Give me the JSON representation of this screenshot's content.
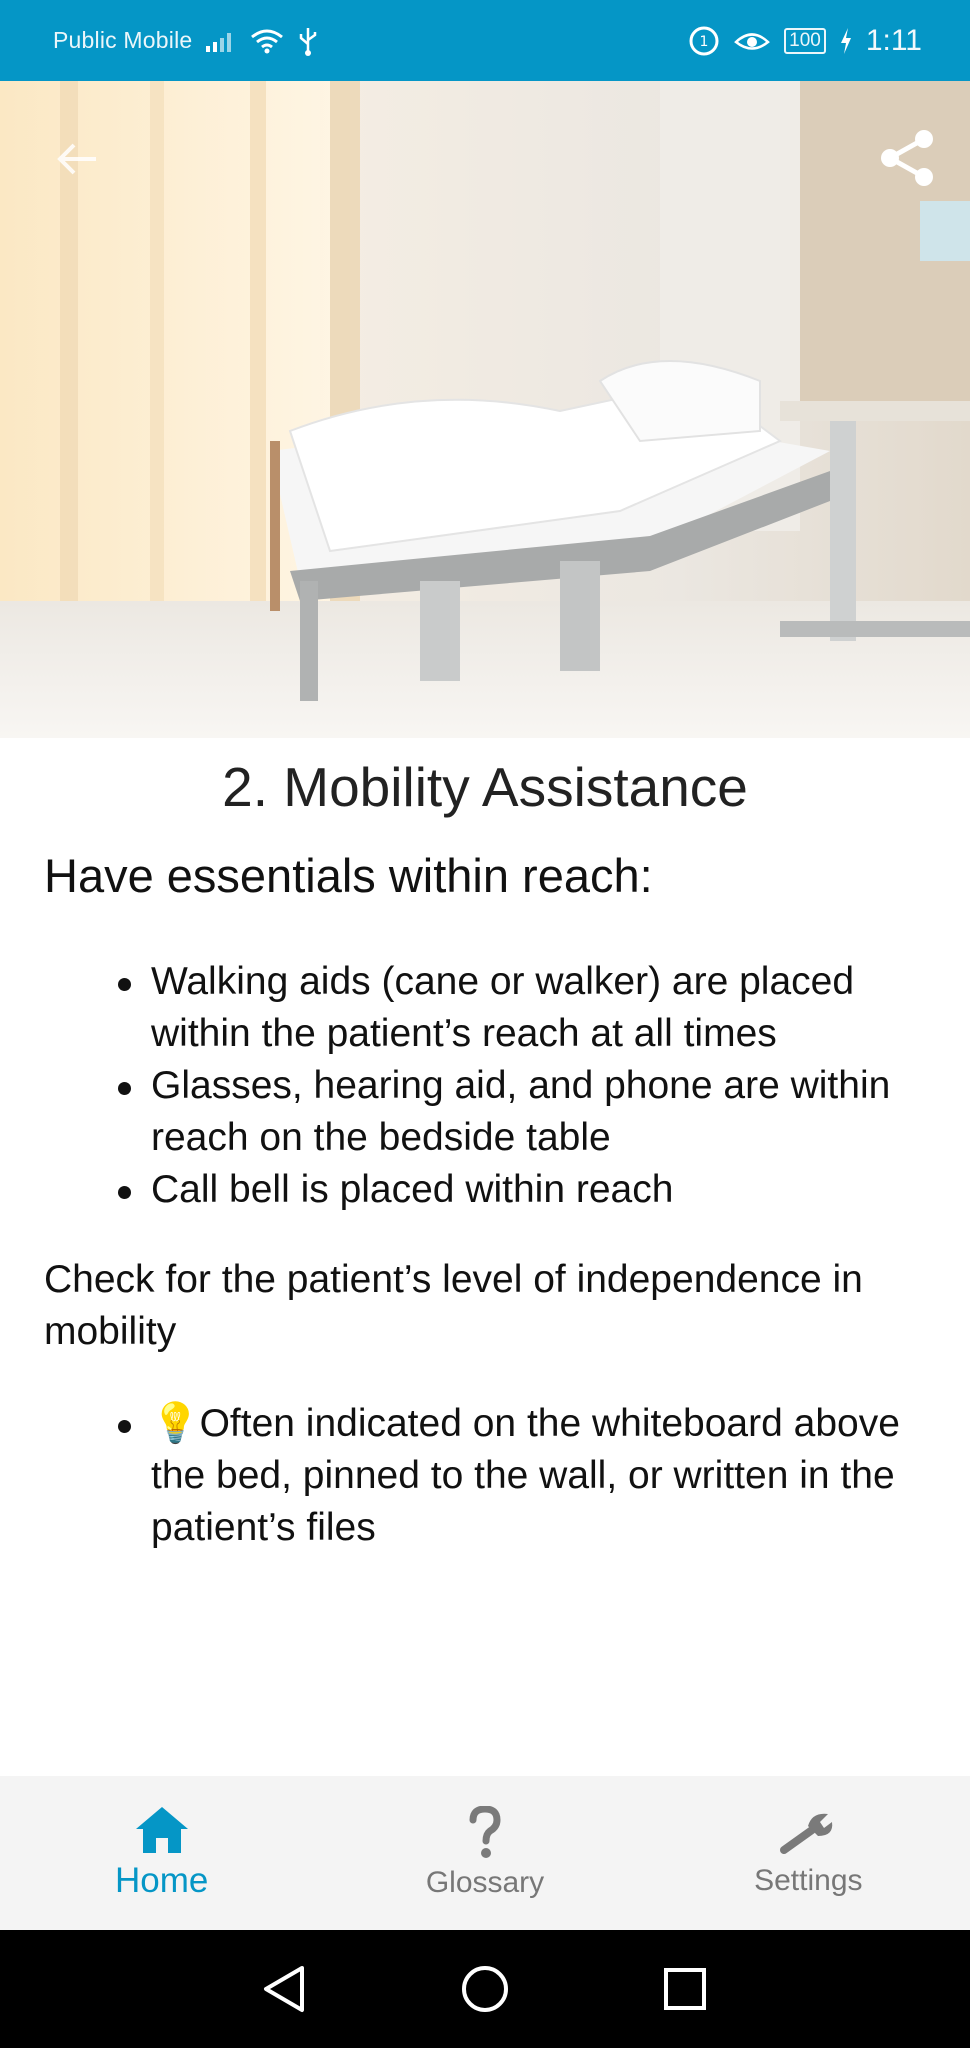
{
  "status_bar": {
    "carrier": "Public Mobile",
    "battery": "100",
    "time": "1:11",
    "background_color": "#0596c6"
  },
  "hero": {
    "image_description_icon": "hospital-bed-photo",
    "back_icon": "arrow-left-icon",
    "share_icon": "share-icon"
  },
  "content": {
    "title": "2. Mobility Assistance",
    "heading": "Have essentials within reach:",
    "essentials": [
      "Walking aids (cane or walker) are placed within the patient’s reach at all times",
      "Glasses, hearing aid, and phone are within reach on the bedside table",
      "Call bell is placed within reach"
    ],
    "paragraph": "Check for the patient’s level of independence in mobility",
    "tip_emoji": "💡",
    "tip_text": "Often indicated on the whiteboard above the bed, pinned to the wall, or written in the patient’s files"
  },
  "bottom_nav": {
    "items": [
      {
        "label": "Home",
        "icon": "home-icon",
        "active": true
      },
      {
        "label": "Glossary",
        "icon": "question-icon",
        "active": false
      },
      {
        "label": "Settings",
        "icon": "wrench-icon",
        "active": false
      }
    ],
    "accent_color": "#0596c6"
  },
  "system_nav": {
    "back": "back-triangle-icon",
    "home": "home-circle-icon",
    "recents": "recents-square-icon"
  }
}
